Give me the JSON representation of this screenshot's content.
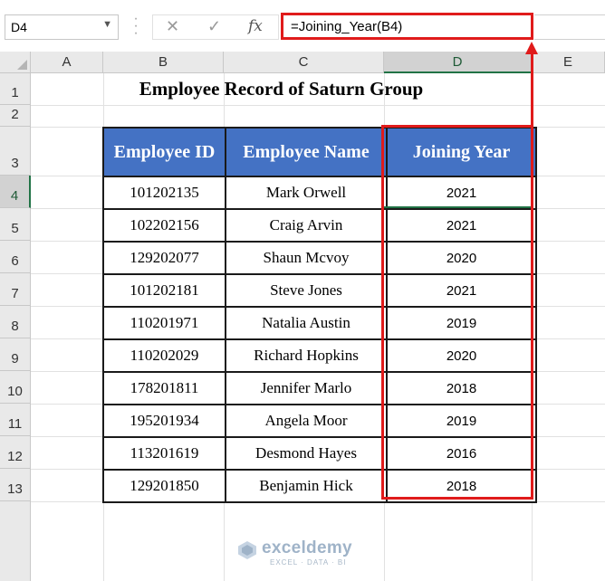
{
  "formula_bar": {
    "name_box": "D4",
    "fx_label": "fx",
    "formula": "=Joining_Year(B4)"
  },
  "columns": [
    "A",
    "B",
    "C",
    "D",
    "E"
  ],
  "rows": [
    "1",
    "2",
    "3",
    "4",
    "5",
    "6",
    "7",
    "8",
    "9",
    "10",
    "11",
    "12",
    "13"
  ],
  "sheet": {
    "title": "Employee Record of Saturn Group",
    "headers": [
      "Employee ID",
      "Employee Name",
      "Joining Year"
    ],
    "records": [
      [
        "101202135",
        "Mark Orwell",
        "2021"
      ],
      [
        "102202156",
        "Craig Arvin",
        "2021"
      ],
      [
        "129202077",
        "Shaun Mcvoy",
        "2020"
      ],
      [
        "101202181",
        "Steve Jones",
        "2021"
      ],
      [
        "110201971",
        "Natalia Austin",
        "2019"
      ],
      [
        "110202029",
        "Richard Hopkins",
        "2020"
      ],
      [
        "178201811",
        "Jennifer Marlo",
        "2018"
      ],
      [
        "195201934",
        "Angela Moor",
        "2019"
      ],
      [
        "113201619",
        "Desmond Hayes",
        "2016"
      ],
      [
        "129201850",
        "Benjamin Hick",
        "2018"
      ]
    ]
  },
  "watermark": {
    "name": "exceldemy",
    "tagline": "EXCEL · DATA · BI"
  },
  "colors": {
    "header_fill": "#4472c4",
    "highlight": "#e01b1b",
    "active_green": "#217346"
  }
}
